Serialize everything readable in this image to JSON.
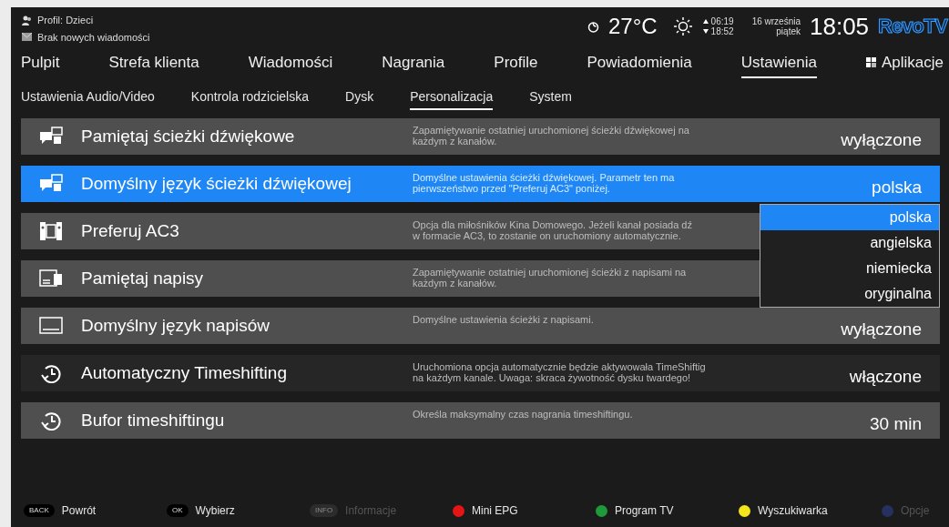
{
  "header": {
    "profile": "Profil: Dzieci",
    "messages": "Brak nowych wiadomości",
    "temperature": "27°C",
    "sunrise": "06:19",
    "sunset": "18:52",
    "date": "16 września",
    "weekday": "piątek",
    "time": "18:05",
    "logo": "RevoTV"
  },
  "main_tabs": [
    {
      "label": "Pulpit",
      "selected": false
    },
    {
      "label": "Strefa klienta",
      "selected": false
    },
    {
      "label": "Wiadomości",
      "selected": false
    },
    {
      "label": "Nagrania",
      "selected": false
    },
    {
      "label": "Profile",
      "selected": false
    },
    {
      "label": "Powiadomienia",
      "selected": false
    },
    {
      "label": "Ustawienia",
      "selected": true
    },
    {
      "label": "Aplikacje",
      "selected": false,
      "kind": "apps"
    }
  ],
  "sub_tabs": [
    {
      "label": "Ustawienia Audio/Video",
      "selected": false
    },
    {
      "label": "Kontrola rodzicielska",
      "selected": false
    },
    {
      "label": "Dysk",
      "selected": false
    },
    {
      "label": "Personalizacja",
      "selected": true
    },
    {
      "label": "System",
      "selected": false
    }
  ],
  "settings": [
    {
      "title": "Pamiętaj ścieżki dźwiękowe",
      "description": [
        "Zapamiętywanie ostatniej uruchomionej ścieżki dźwiękowej na",
        "każdym z kanałów."
      ],
      "value": "wyłączone",
      "selected": false,
      "dark": false
    },
    {
      "title": "Domyślny język ścieżki dźwiękowej",
      "description": [
        "Domyślne ustawienia ścieżki dźwiękowej. Parametr ten ma",
        "pierwszeństwo przed \"Preferuj AC3\" poniżej."
      ],
      "value": "polska",
      "selected": true,
      "dark": false
    },
    {
      "title": "Preferuj AC3",
      "description": [
        "Opcja dla miłośników Kina Domowego. Jeżeli kanał posiada dź",
        "w formacie AC3, to zostanie on uruchomiony automatycznie."
      ],
      "selected": false,
      "dark": false
    },
    {
      "title": "Pamiętaj napisy",
      "description": [
        "Zapamiętywanie ostatniej uruchomionej ścieżki z napisami na",
        "każdym z kanałów."
      ],
      "selected": false,
      "dark": false
    },
    {
      "title": "Domyślny język napisów",
      "description": [
        "Domyślne ustawienia ścieżki z napisami."
      ],
      "value": "wyłączone",
      "selected": false,
      "dark": false
    },
    {
      "title": "Automatyczny Timeshifting",
      "description": [
        "Uruchomiona opcja automatycznie będzie aktywowała TimeShiftig",
        "na każdym kanale. Uwaga: skraca żywotność dysku twardego!"
      ],
      "value": "włączone",
      "selected": false,
      "dark": true
    },
    {
      "title": "Bufor timeshiftingu",
      "description": [
        "Określa maksymalny czas nagrania timeshiftingu."
      ],
      "value": "30 min",
      "selected": false,
      "dark": false
    }
  ],
  "dropdown": {
    "options": [
      {
        "label": "polska",
        "selected": true
      },
      {
        "label": "angielska",
        "selected": false
      },
      {
        "label": "niemiecka",
        "selected": false
      },
      {
        "label": "oryginalna",
        "selected": false
      }
    ]
  },
  "footer": [
    {
      "kind": "key",
      "key": "BACK",
      "label": "Powrót",
      "disabled": false
    },
    {
      "kind": "key",
      "key": "OK",
      "label": "Wybierz",
      "disabled": false
    },
    {
      "kind": "key",
      "key": "INFO",
      "label": "Informacje",
      "disabled": true
    },
    {
      "kind": "dot",
      "color": "#e51515",
      "label": "Mini EPG",
      "disabled": false
    },
    {
      "kind": "dot",
      "color": "#1f9a3a",
      "label": "Program TV",
      "disabled": false
    },
    {
      "kind": "dot",
      "color": "#f2e61a",
      "label": "Wyszukiwarka",
      "disabled": false
    },
    {
      "kind": "dot",
      "color": "#27305e",
      "label": "Opcje",
      "disabled": true
    }
  ]
}
